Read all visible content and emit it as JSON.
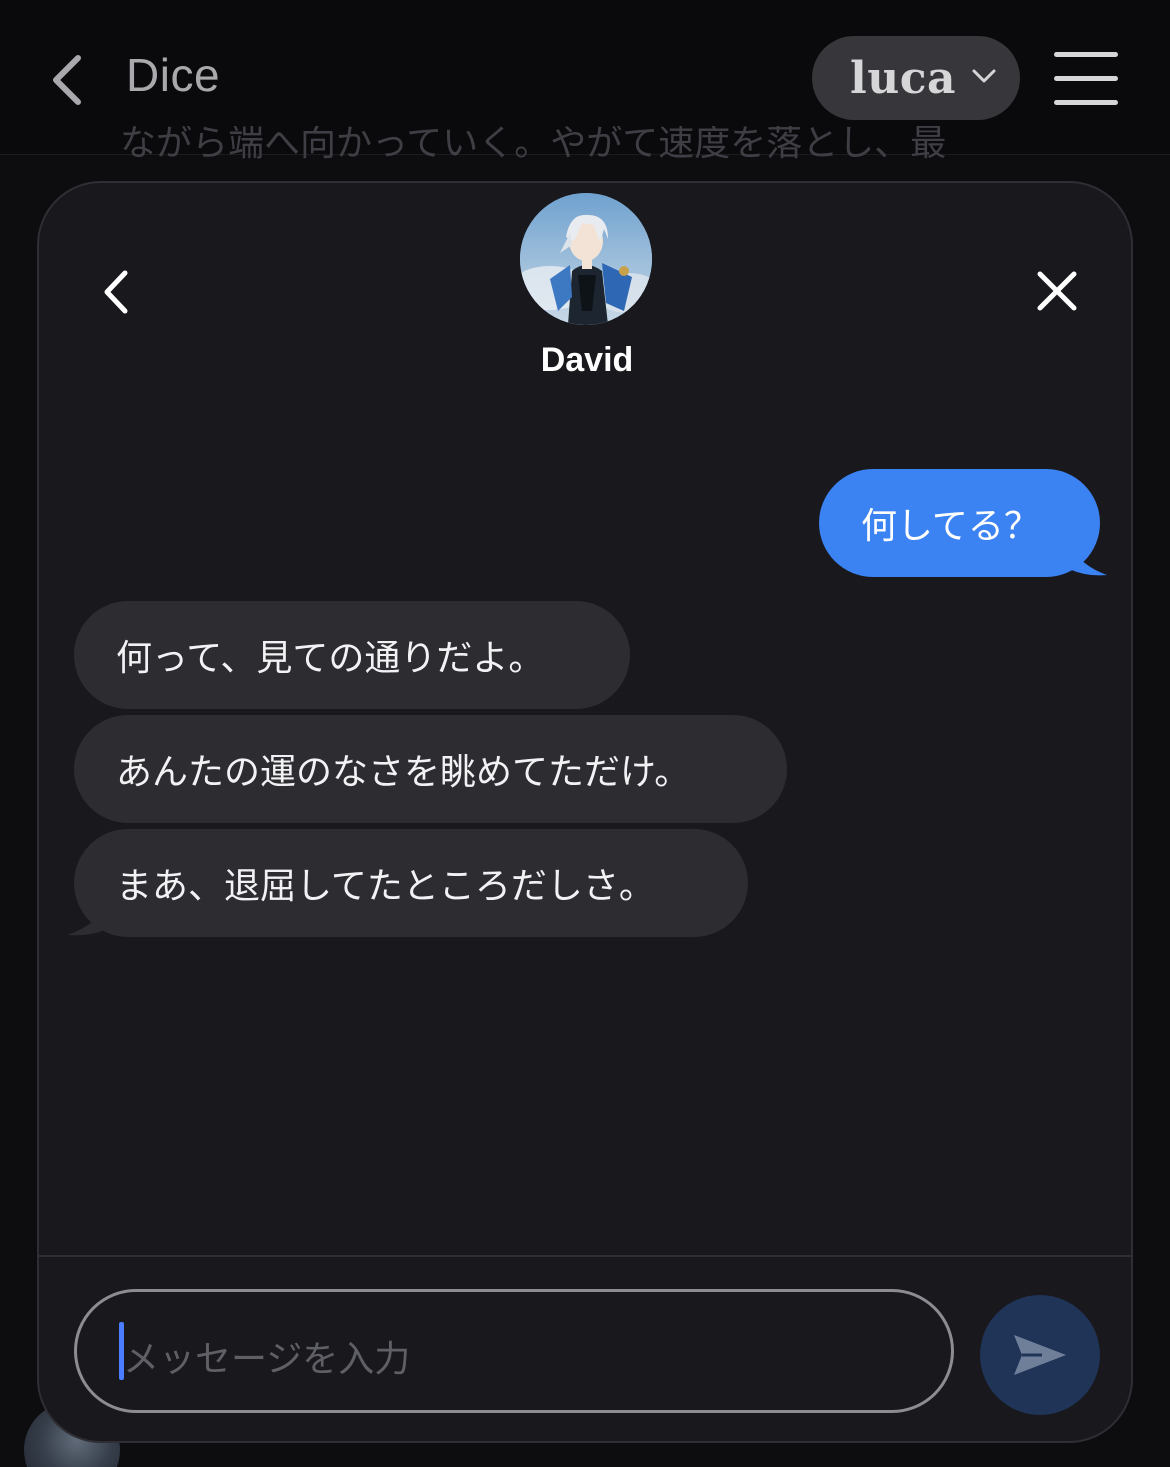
{
  "topbar": {
    "title": "Dice",
    "user_name": "luca"
  },
  "background": {
    "story_snippet": "ながら端へ向かっていく。やがて速度を落とし、最"
  },
  "chat": {
    "partner_name": "David",
    "messages": [
      {
        "from": "me",
        "text": "何してる？"
      },
      {
        "from": "partner",
        "text": "何って、見ての通りだよ。"
      },
      {
        "from": "partner",
        "text": "あんたの運のなさを眺めてただけ。"
      },
      {
        "from": "partner",
        "text": "まあ、退屈してたところだしさ。"
      }
    ],
    "input": {
      "placeholder": "メッセージを入力",
      "value": ""
    }
  },
  "colors": {
    "outgoing_bubble": "#3b82f2",
    "incoming_bubble": "#2c2c31",
    "modal_bg": "#18181d",
    "send_button": "#1f3457"
  }
}
